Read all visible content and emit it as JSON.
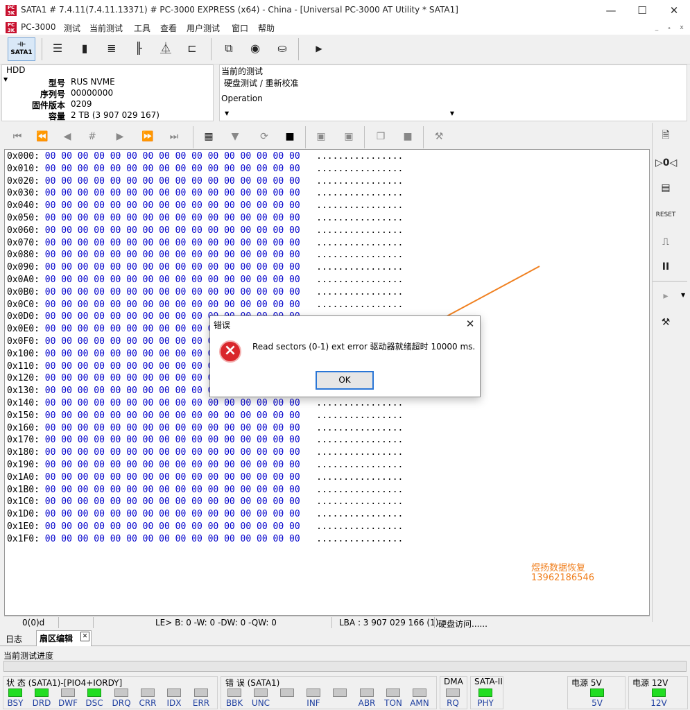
{
  "window": {
    "title": "SATA1 # 7.4.11(7.4.11.13371) # PC-3000 EXPRESS (x64) - China - [Universal PC-3000 AT Utility * SATA1]",
    "minimize": "—",
    "maximize": "☐",
    "close": "✕"
  },
  "menu": {
    "app": "PC-3000",
    "items": [
      "测试",
      "当前测试",
      "工具",
      "查看",
      "用户测试",
      "窗口",
      "帮助"
    ],
    "mdi_min": "_",
    "mdi_restore": "ₐ",
    "mdi_close": "x"
  },
  "toolbar": {
    "sata1_label": "SATA1"
  },
  "hdd": {
    "section": "HDD",
    "labels": {
      "model": "型号",
      "serial": "序列号",
      "firmware": "固件版本",
      "capacity": "容量"
    },
    "model": "RUS NVME",
    "serial": "00000000",
    "firmware": "0209",
    "capacity": "2 TB (3 907 029 167)"
  },
  "test": {
    "current_label": "当前的测试",
    "current_value": "硬盘测试 / 重新校准",
    "operation_label": "Operation"
  },
  "hex": {
    "bytes": "00 00 00 00 00 00 00 00 00 00 00 00 00 00 00 00",
    "ascii": "................",
    "offsets": [
      "0x000:",
      "0x010:",
      "0x020:",
      "0x030:",
      "0x040:",
      "0x050:",
      "0x060:",
      "0x070:",
      "0x080:",
      "0x090:",
      "0x0A0:",
      "0x0B0:",
      "0x0C0:",
      "0x0D0:",
      "0x0E0:",
      "0x0F0:",
      "0x100:",
      "0x110:",
      "0x120:",
      "0x130:",
      "0x140:",
      "0x150:",
      "0x160:",
      "0x170:",
      "0x180:",
      "0x190:",
      "0x1A0:",
      "0x1B0:",
      "0x1C0:",
      "0x1D0:",
      "0x1E0:",
      "0x1F0:"
    ]
  },
  "watermark": {
    "line1": "煜扬数据恢复",
    "line2": "13962186546"
  },
  "statusbar": {
    "sector": "0(0)d",
    "counters": "LE> B: 0 -W: 0 -DW: 0 -QW: 0",
    "lba": "LBA : 3 907 029 166 (1)",
    "access": "硬盘访问......"
  },
  "tabs": {
    "log": "日志",
    "sector_editor": "扇区编辑",
    "close": "✕"
  },
  "progress_label": "当前测试进度",
  "indicators": {
    "status_title": "状 态 (SATA1)-[PIO4+IORDY]",
    "error_title": "错 误 (SATA1)",
    "dma_title": "DMA",
    "sata_title": "SATA-II",
    "power5_title": "电源 5V",
    "power12_title": "电源 12V",
    "status": [
      {
        "label": "BSY",
        "on": true
      },
      {
        "label": "DRD",
        "on": true
      },
      {
        "label": "DWF",
        "on": false
      },
      {
        "label": "DSC",
        "on": true
      },
      {
        "label": "DRQ",
        "on": false
      },
      {
        "label": "CRR",
        "on": false
      },
      {
        "label": "IDX",
        "on": false
      },
      {
        "label": "ERR",
        "on": false
      }
    ],
    "errors": [
      {
        "label": "BBK",
        "on": false
      },
      {
        "label": "UNC",
        "on": false
      },
      {
        "label": "",
        "on": false
      },
      {
        "label": "INF",
        "on": false
      },
      {
        "label": "",
        "on": false
      },
      {
        "label": "ABR",
        "on": false
      },
      {
        "label": "TON",
        "on": false
      },
      {
        "label": "AMN",
        "on": false
      }
    ],
    "dma": {
      "label": "RQ",
      "on": false
    },
    "sata": {
      "label": "PHY",
      "on": true
    },
    "p5": {
      "label": "5V",
      "on": true
    },
    "p12": {
      "label": "12V",
      "on": true
    }
  },
  "dialog": {
    "title": "错误",
    "message": "Read sectors (0-1) ext error 驱动器就绪超时 10000 ms.",
    "ok": "OK",
    "close": "✕"
  },
  "colors": {
    "accent_arrow": "#f08020",
    "hex_bytes": "#0000cc",
    "led_on": "#22dd22"
  }
}
